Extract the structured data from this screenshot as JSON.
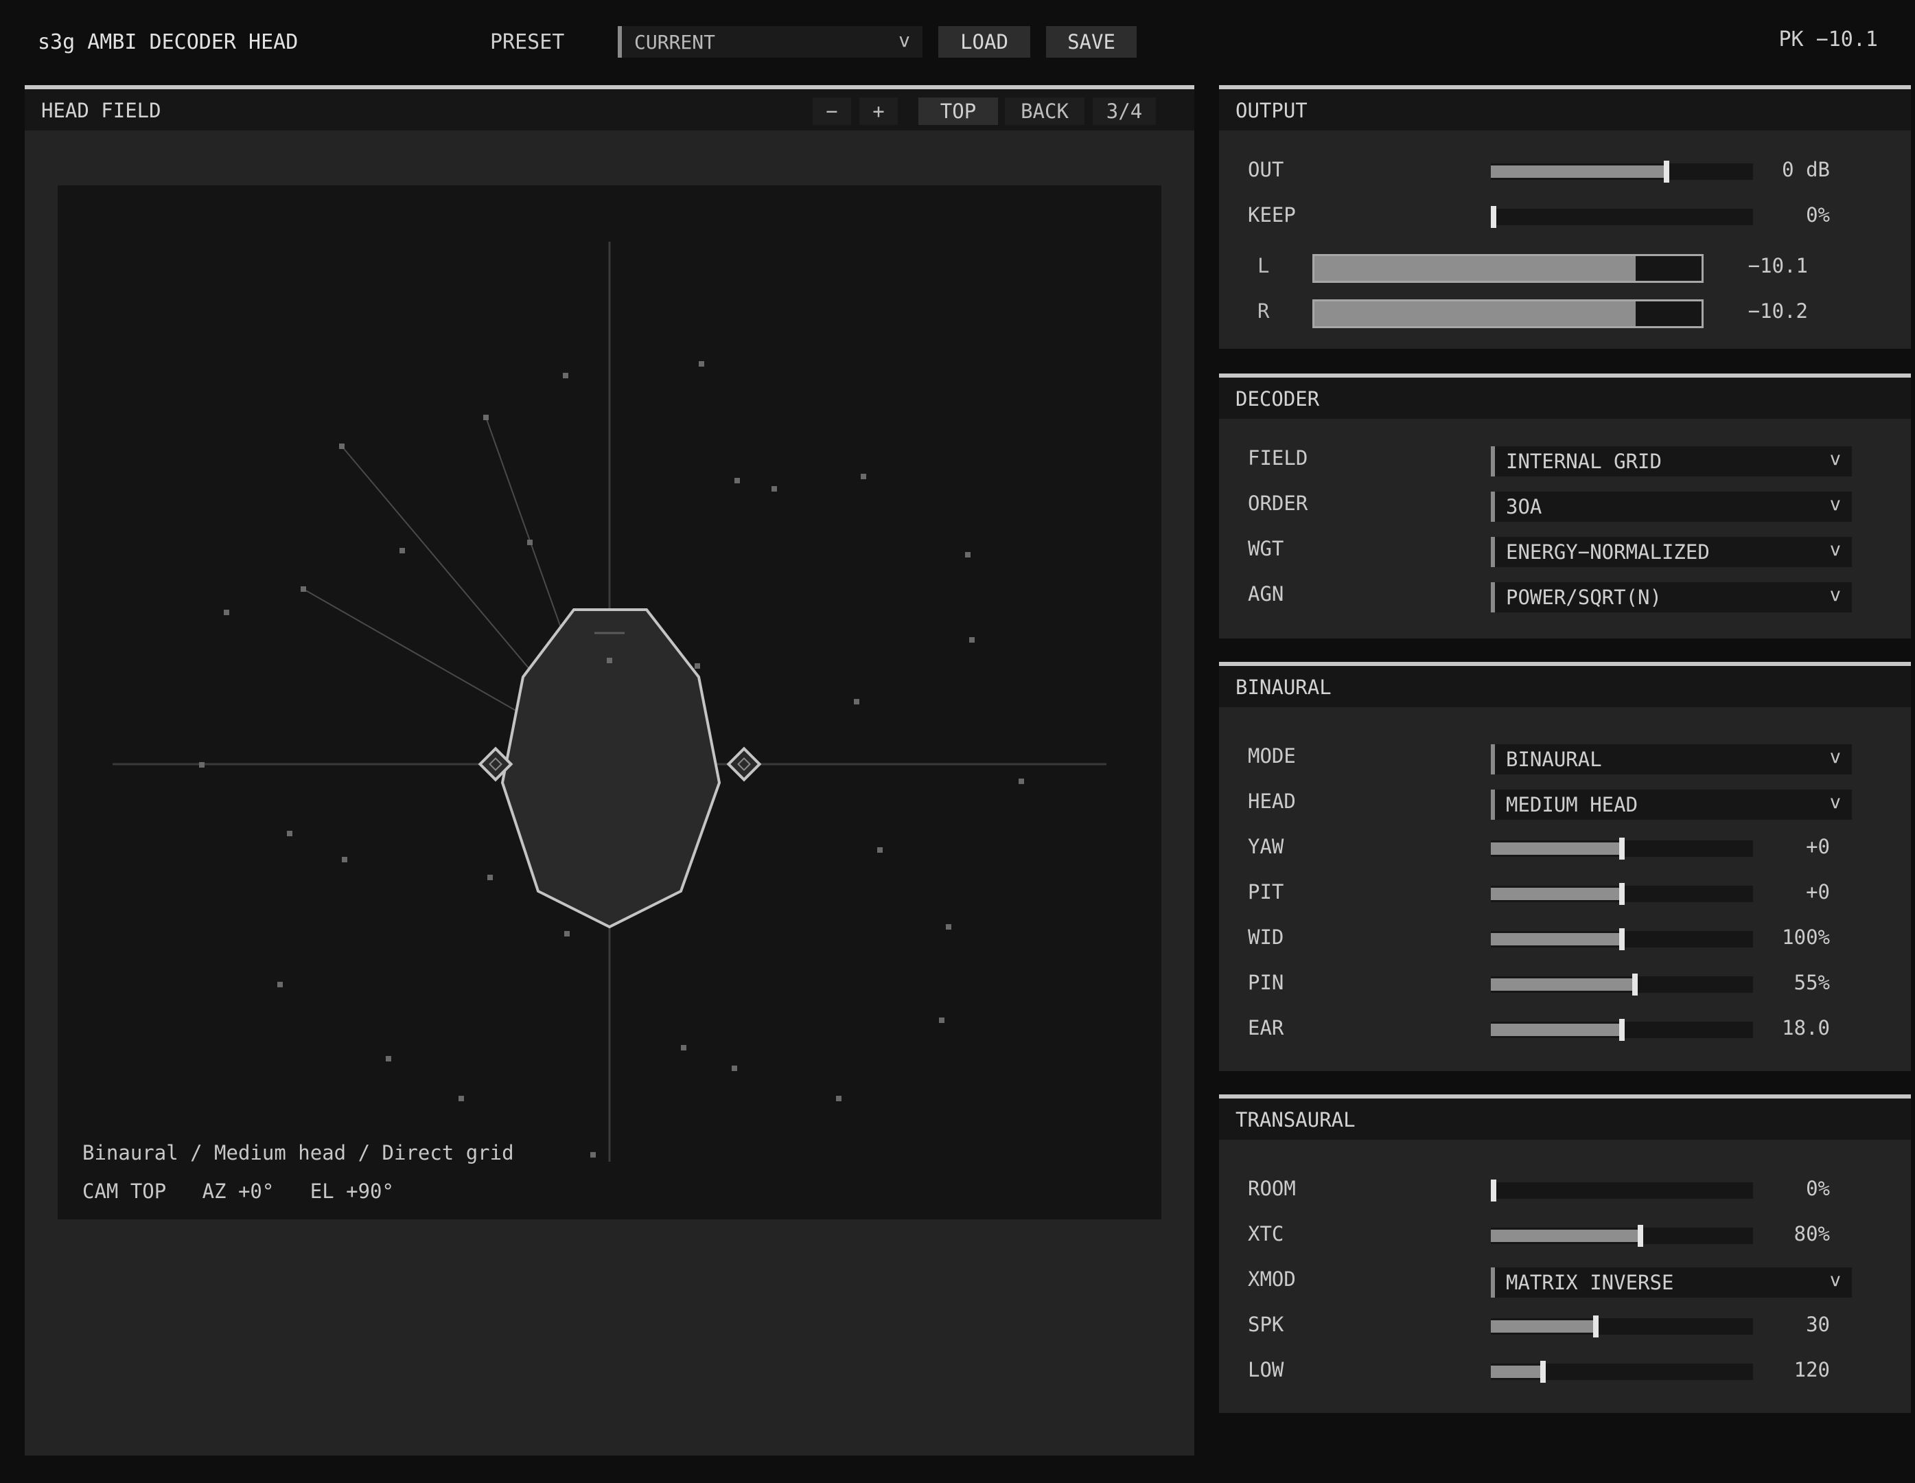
{
  "app": {
    "title": "s3g AMBI DECODER HEAD",
    "preset_label": "PRESET",
    "preset_value": "CURRENT",
    "load_label": "LOAD",
    "save_label": "SAVE",
    "peak": "PK −10.1"
  },
  "head_field": {
    "title": "HEAD FIELD",
    "zoom_out": "−",
    "zoom_in": "+",
    "view_top": "TOP",
    "view_back": "BACK",
    "page": "3/4",
    "caption": "Binaural / Medium head / Direct grid",
    "camera": "CAM TOP   AZ +0°   EL +90°"
  },
  "output": {
    "title": "OUTPUT",
    "rows": [
      {
        "label": "OUT",
        "value": "0 dB",
        "level": 0.67
      },
      {
        "label": "KEEP",
        "value": "0%",
        "level": 0.0
      }
    ],
    "meters": [
      {
        "label": "L",
        "value": "−10.1",
        "level": 0.83
      },
      {
        "label": "R",
        "value": "−10.2",
        "level": 0.83
      }
    ]
  },
  "decoder": {
    "title": "DECODER",
    "rows": [
      {
        "label": "FIELD",
        "value": "INTERNAL GRID"
      },
      {
        "label": "ORDER",
        "value": "3OA"
      },
      {
        "label": "WGT",
        "value": "ENERGY−NORMALIZED"
      },
      {
        "label": "AGN",
        "value": "POWER/SQRT(N)"
      }
    ]
  },
  "binaural": {
    "title": "BINAURAL",
    "mode_label": "MODE",
    "mode_value": "BINAURAL",
    "head_label": "HEAD",
    "head_value": "MEDIUM HEAD",
    "sliders": [
      {
        "label": "YAW",
        "value": "+0",
        "level": 0.5
      },
      {
        "label": "PIT",
        "value": "+0",
        "level": 0.5
      },
      {
        "label": "WID",
        "value": "100%",
        "level": 0.5
      },
      {
        "label": "PIN",
        "value": "55%",
        "level": 0.55
      },
      {
        "label": "EAR",
        "value": "18.0",
        "level": 0.5
      }
    ]
  },
  "transaural": {
    "title": "TRANSAURAL",
    "room_label": "ROOM",
    "room_value": "0%",
    "room_level": 0.0,
    "xtc_label": "XTC",
    "xtc_value": "80%",
    "xtc_level": 0.57,
    "xmod_label": "XMOD",
    "xmod_value": "MATRIX INVERSE",
    "spk_label": "SPK",
    "spk_value": "30",
    "spk_level": 0.4,
    "low_label": "LOW",
    "low_value": "120",
    "low_level": 0.2
  },
  "icons": {
    "chevron": "v"
  },
  "colors": {
    "background": "#0e0e0e",
    "panel": "#242424",
    "viewport": "#141414",
    "accent": "#c7c7c7"
  }
}
